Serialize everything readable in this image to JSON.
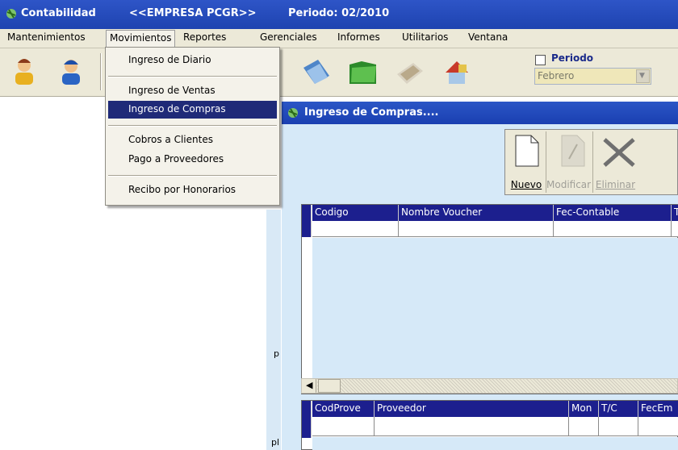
{
  "titlebar": {
    "app": "Contabilidad",
    "empresa": "<<EMPRESA PCGR>>",
    "periodo": "Periodo: 02/2010"
  },
  "menubar": {
    "items": [
      "Mantenimientos",
      "Movimientos",
      "Reportes",
      "Gerenciales",
      "Informes",
      "Utilitarios",
      "Ventana"
    ]
  },
  "toolbar": {
    "periodo_label": "Periodo",
    "periodo_value": "Febrero",
    "periodo_checked": false,
    "icons": [
      "user-icon",
      "worker-icon",
      "books-icon",
      "folder-icon",
      "money-icon",
      "house-icon"
    ]
  },
  "dropdown": {
    "items": [
      {
        "label": "Ingreso de Diario",
        "highlighted": false
      },
      {
        "label": "Ingreso de Ventas",
        "highlighted": false
      },
      {
        "label": "Ingreso de Compras",
        "highlighted": true
      },
      {
        "label": "Cobros a Clientes",
        "highlighted": false
      },
      {
        "label": "Pago a Proveedores",
        "highlighted": false
      },
      {
        "label": "Recibo por Honorarios",
        "highlighted": false
      }
    ]
  },
  "child_window": {
    "title": "Ingreso de Compras....",
    "buttons": {
      "nuevo": "Nuevo",
      "modificar": "Modificar",
      "eliminar": "Eliminar"
    },
    "grid1": {
      "columns": [
        "Codigo",
        "Nombre Voucher",
        "Fec-Contable",
        "T"
      ]
    },
    "grid2": {
      "columns": [
        "CodProve",
        "Proveedor",
        "Mon",
        "T/C",
        "FecEm"
      ]
    }
  },
  "left_strip": {
    "chars": [
      "p",
      "pl"
    ]
  },
  "colors": {
    "title_blue": "#1e43b0",
    "grid_header": "#1c1f8e",
    "menu_highlight": "#1f2a78",
    "window_bg": "#d6e9f8"
  }
}
